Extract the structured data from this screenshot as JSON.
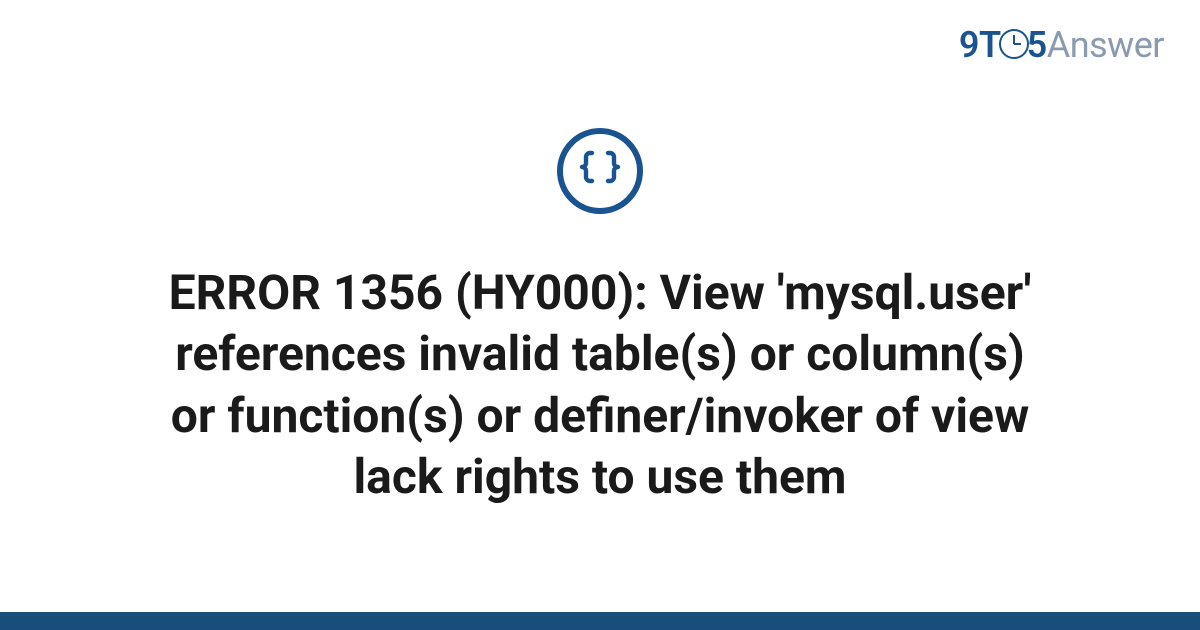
{
  "brand": {
    "part1": "9",
    "part2": "T",
    "part3": "5",
    "part4": "Answer"
  },
  "icon_name": "code-braces-icon",
  "title": "ERROR 1356 (HY000): View 'mysql.user' references invalid table(s) or column(s) or function(s) or definer/invoker of view lack rights to use them",
  "colors": {
    "brand_primary": "#1a5490",
    "brand_secondary": "#8a9bb0",
    "text": "#1a1a1a",
    "bottom_bar": "#1a4e7a"
  }
}
